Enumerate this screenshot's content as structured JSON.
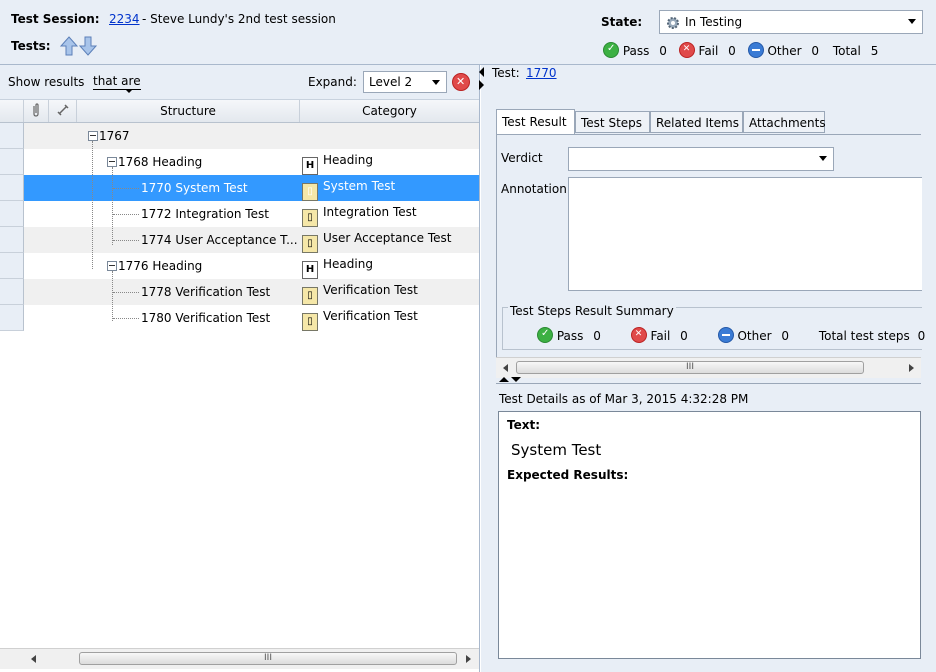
{
  "header": {
    "session_label": "Test Session:",
    "session_id": "2234",
    "session_desc": "- Steve Lundy's 2nd test session",
    "tests_label": "Tests:",
    "state_label": "State:",
    "state_value": "In Testing",
    "counts": {
      "pass_label": "Pass",
      "pass": "0",
      "fail_label": "Fail",
      "fail": "0",
      "other_label": "Other",
      "other": "0",
      "total_label": "Total",
      "total": "5"
    }
  },
  "left": {
    "show_results_label": "Show results",
    "filter_value": "that are",
    "expand_label": "Expand:",
    "expand_value": "Level 2",
    "columns": {
      "structure": "Structure",
      "category": "Category"
    },
    "rows": [
      {
        "id": "1767",
        "label": "1767",
        "category": ""
      },
      {
        "id": "1768",
        "label": "1768 Heading",
        "category": "Heading"
      },
      {
        "id": "1770",
        "label": "1770 System Test",
        "category": "System Test"
      },
      {
        "id": "1772",
        "label": "1772 Integration Test",
        "category": "Integration Test"
      },
      {
        "id": "1774",
        "label": "1774 User Acceptance T...",
        "category": "User Acceptance Test"
      },
      {
        "id": "1776",
        "label": "1776 Heading",
        "category": "Heading"
      },
      {
        "id": "1778",
        "label": "1778 Verification Test",
        "category": "Verification Test"
      },
      {
        "id": "1780",
        "label": "1780 Verification Test",
        "category": "Verification Test"
      }
    ],
    "scroll_thumb_label": "III"
  },
  "right": {
    "test_label": "Test:",
    "test_id": "1770",
    "tabs": [
      "Test Result",
      "Test Steps",
      "Related Items",
      "Attachments"
    ],
    "verdict_label": "Verdict",
    "annotation_label": "Annotation",
    "summary_title": "Test Steps Result Summary",
    "summary": {
      "pass_label": "Pass",
      "pass": "0",
      "fail_label": "Fail",
      "fail": "0",
      "other_label": "Other",
      "other": "0",
      "total_label": "Total test steps",
      "total": "0"
    },
    "scroll_thumb_label": "III",
    "details_header": "Test Details as of Mar 3, 2015 4:32:28 PM",
    "details": {
      "text_label": "Text:",
      "text_value": "System Test",
      "expected_label": "Expected Results:"
    }
  }
}
